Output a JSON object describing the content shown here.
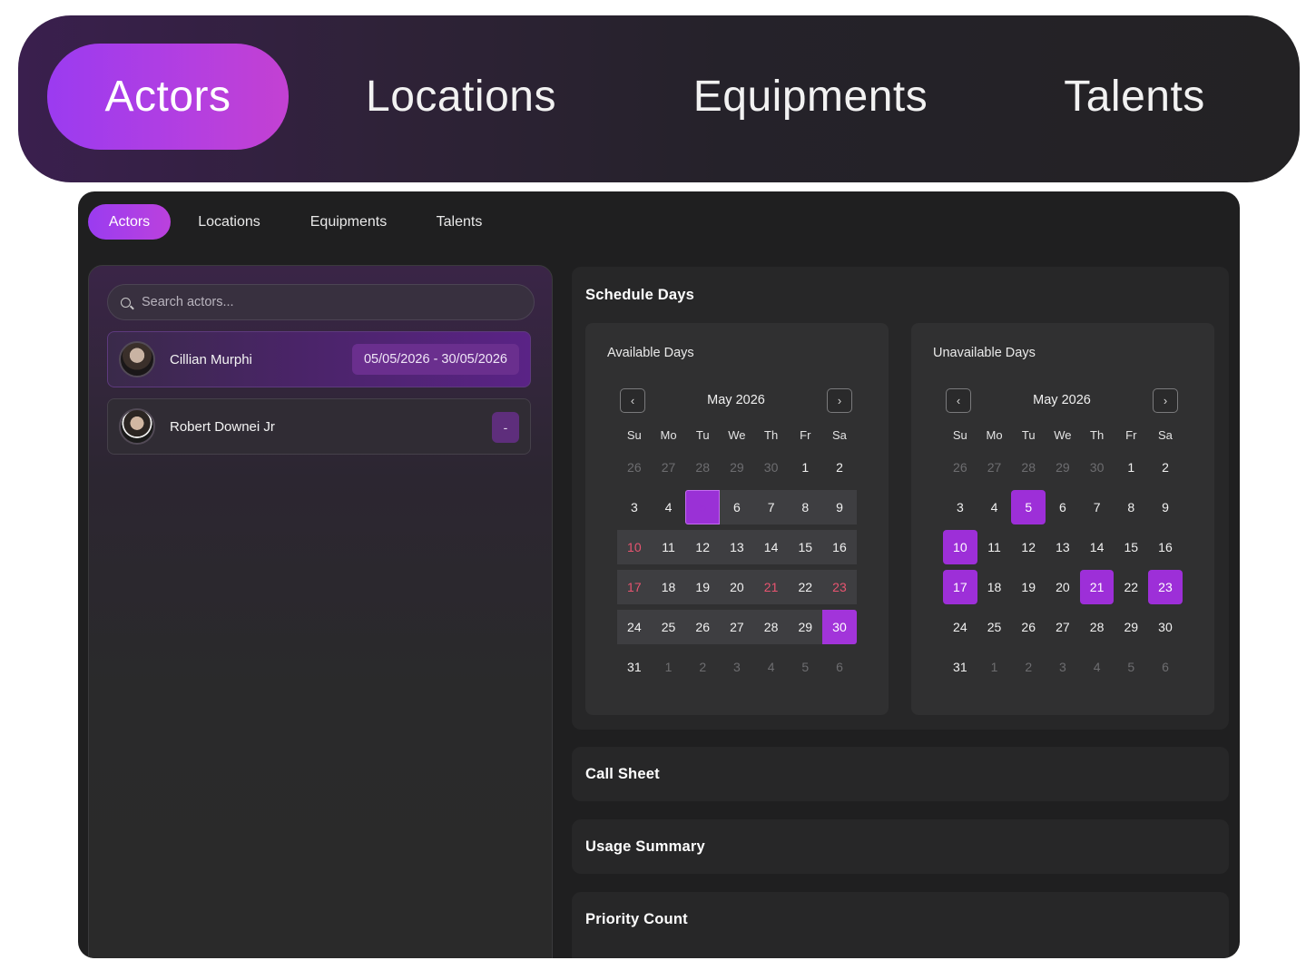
{
  "tabs": [
    "Actors",
    "Locations",
    "Equipments",
    "Talents"
  ],
  "active_tab": "Actors",
  "search": {
    "placeholder": "Search actors..."
  },
  "actors": [
    {
      "name": "Cillian Murphi",
      "badge": "05/05/2026 - 30/05/2026",
      "selected": true
    },
    {
      "name": "Robert Downei Jr",
      "badge": "-",
      "selected": false
    }
  ],
  "schedule": {
    "title": "Schedule Days",
    "available": {
      "title": "Available Days",
      "month": "May 2026",
      "prev_icon": "chevron-left-icon",
      "next_icon": "chevron-right-icon"
    },
    "unavailable": {
      "title": "Unavailable Days",
      "month": "May 2026",
      "prev_icon": "chevron-left-icon",
      "next_icon": "chevron-right-icon"
    },
    "weekdays": [
      "Su",
      "Mo",
      "Tu",
      "We",
      "Th",
      "Fr",
      "Sa"
    ],
    "weeks": [
      [
        "26",
        "27",
        "28",
        "29",
        "30",
        "1",
        "2"
      ],
      [
        "3",
        "4",
        "5",
        "6",
        "7",
        "8",
        "9"
      ],
      [
        "10",
        "11",
        "12",
        "13",
        "14",
        "15",
        "16"
      ],
      [
        "17",
        "18",
        "19",
        "20",
        "21",
        "22",
        "23"
      ],
      [
        "24",
        "25",
        "26",
        "27",
        "28",
        "29",
        "30"
      ],
      [
        "31",
        "1",
        "2",
        "3",
        "4",
        "5",
        "6"
      ]
    ]
  },
  "sections": {
    "call_sheet": "Call Sheet",
    "usage_summary": "Usage Summary",
    "priority_count": "Priority Count"
  },
  "colors": {
    "accent": "#9b2fd4",
    "weekend_red": "#e85470",
    "background": "#1f1f20"
  }
}
